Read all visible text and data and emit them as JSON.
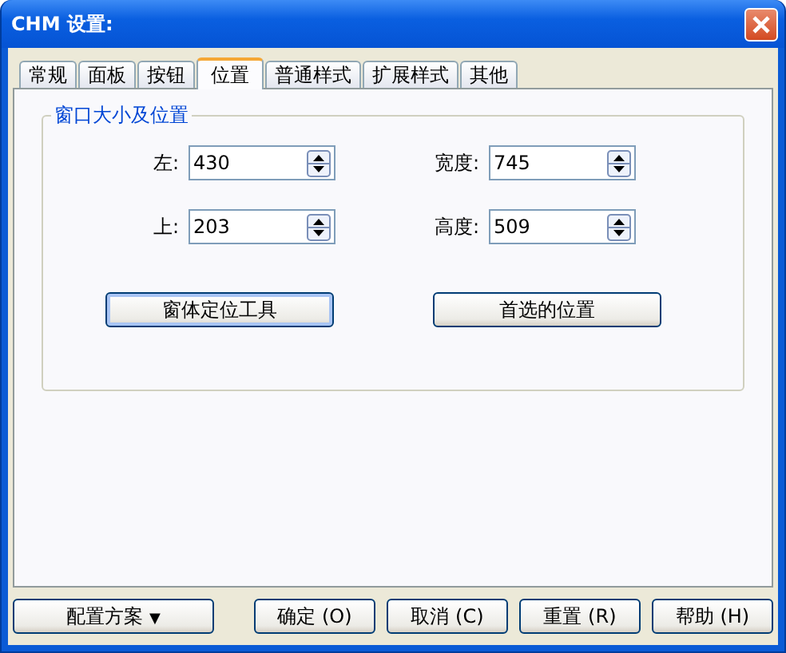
{
  "window": {
    "title": "CHM 设置:"
  },
  "tabs": [
    {
      "label": "常规",
      "selected": false
    },
    {
      "label": "面板",
      "selected": false
    },
    {
      "label": "按钮",
      "selected": false
    },
    {
      "label": "位置",
      "selected": true
    },
    {
      "label": "普通样式",
      "selected": false
    },
    {
      "label": "扩展样式",
      "selected": false
    },
    {
      "label": "其他",
      "selected": false
    }
  ],
  "group": {
    "title": "窗口大小及位置",
    "fields": [
      {
        "label": "左:",
        "value": "430"
      },
      {
        "label": "宽度:",
        "value": "745"
      },
      {
        "label": "上:",
        "value": "203"
      },
      {
        "label": "高度:",
        "value": "509"
      }
    ],
    "buttons": [
      {
        "label": "窗体定位工具",
        "focused": true
      },
      {
        "label": "首选的位置",
        "focused": false
      }
    ]
  },
  "footer": {
    "menu_button": {
      "label": "配置方案",
      "caret": "▼"
    },
    "buttons": [
      "确定 (O)",
      "取消 (C)",
      "重置 (R)",
      "帮助 (H)"
    ]
  }
}
